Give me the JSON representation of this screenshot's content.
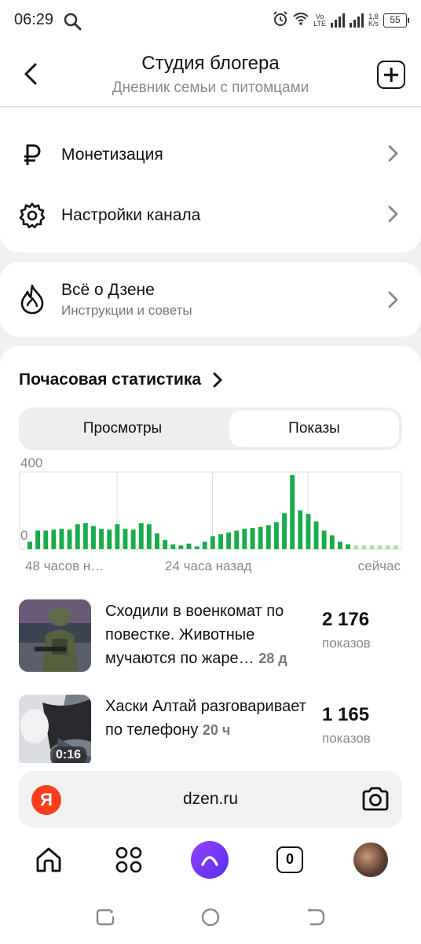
{
  "status_bar": {
    "time": "06:29",
    "net_lte_top": "Vo",
    "net_lte_bottom": "LTE",
    "speed_value": "1,8",
    "speed_unit": "K/s",
    "battery": "55"
  },
  "header": {
    "title": "Студия блогера",
    "subtitle": "Дневник семьи с питомцами"
  },
  "menu": {
    "monetization": "Монетизация",
    "channel_settings": "Настройки канала",
    "about_title": "Всё о Дзене",
    "about_subtitle": "Инструкции и советы"
  },
  "stats": {
    "title": "Почасовая статистика",
    "tabs": [
      "Просмотры",
      "Показы"
    ],
    "active_tab": "Показы"
  },
  "chart_data": {
    "type": "bar",
    "title": "",
    "ylabel": "",
    "ylim": [
      0,
      400
    ],
    "y_ticks": [
      "400",
      "0"
    ],
    "x_labels": [
      "48 часов н…",
      "24 часа назад",
      "сейчас"
    ],
    "grid": true,
    "series": [
      {
        "values": [
          40,
          100,
          100,
          105,
          110,
          105,
          135,
          140,
          125,
          110,
          105,
          135,
          110,
          105,
          140,
          135,
          85,
          50,
          25,
          20,
          30,
          15,
          40,
          70,
          80,
          90,
          100,
          110,
          115,
          120,
          130,
          145,
          195,
          400,
          210,
          190,
          150,
          100,
          75,
          40,
          25
        ]
      }
    ],
    "faded_values": [
      20,
      20,
      20,
      20,
      20,
      20
    ]
  },
  "articles": [
    {
      "title": "Сходили в военкомат по повестке. Животные мучаются по жаре…",
      "age": "28 д",
      "count": "2 176",
      "unit": "показов"
    },
    {
      "title": "Хаски Алтай разговаривает по телефону",
      "age": "20 ч",
      "count": "1 165",
      "unit": "показов",
      "duration": "0:16"
    }
  ],
  "browser": {
    "logo": "Я",
    "url": "dzen.ru",
    "tabs_count": "0"
  },
  "colors": {
    "bar": "#1aab4b",
    "bar_faded": "#a7dfb8",
    "accent": "#6c36f5",
    "yandex": "#fc3f1d"
  }
}
